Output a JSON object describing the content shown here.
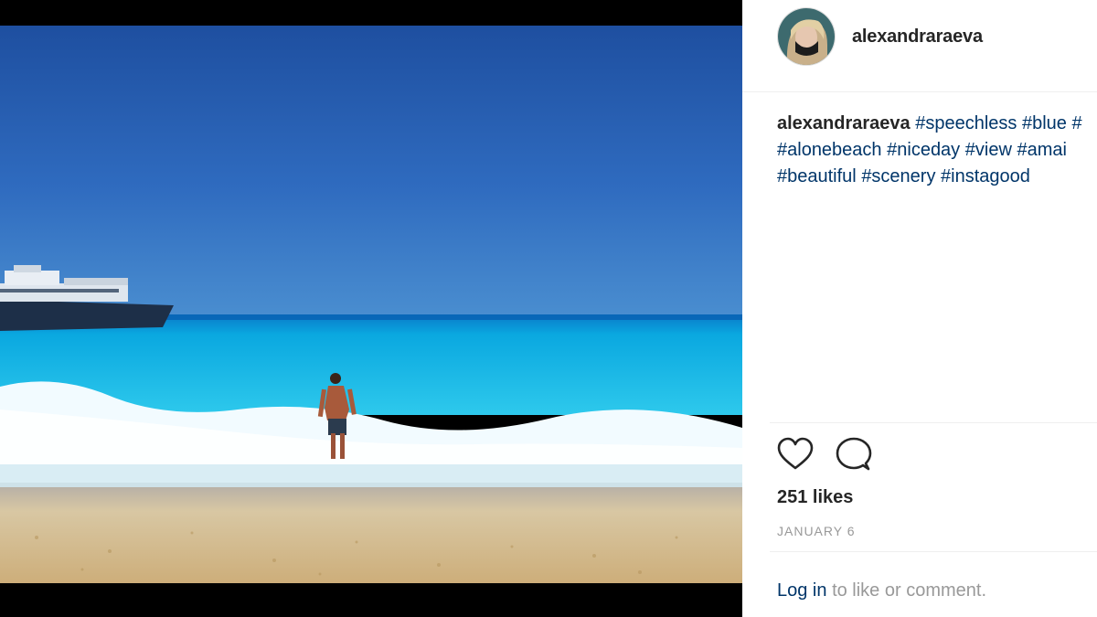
{
  "post": {
    "username": "alexandraraeva",
    "caption": {
      "username": "alexandraraeva",
      "lines": [
        [
          "#speechless",
          "#blue",
          "#"
        ],
        [
          "#alonebeach",
          "#niceday",
          "#view",
          "#amai"
        ],
        [
          "#beautiful",
          "#scenery",
          "#instagood"
        ]
      ]
    },
    "likes": "251 likes",
    "date": "JANUARY 6",
    "login": {
      "link": "Log in",
      "rest": "to like or comment."
    }
  },
  "icons": {
    "like": "heart-icon",
    "comment": "comment-icon"
  },
  "colors": {
    "username": "#262626",
    "hashtag": "#003569",
    "muted": "#999999",
    "divider": "#efefef"
  }
}
